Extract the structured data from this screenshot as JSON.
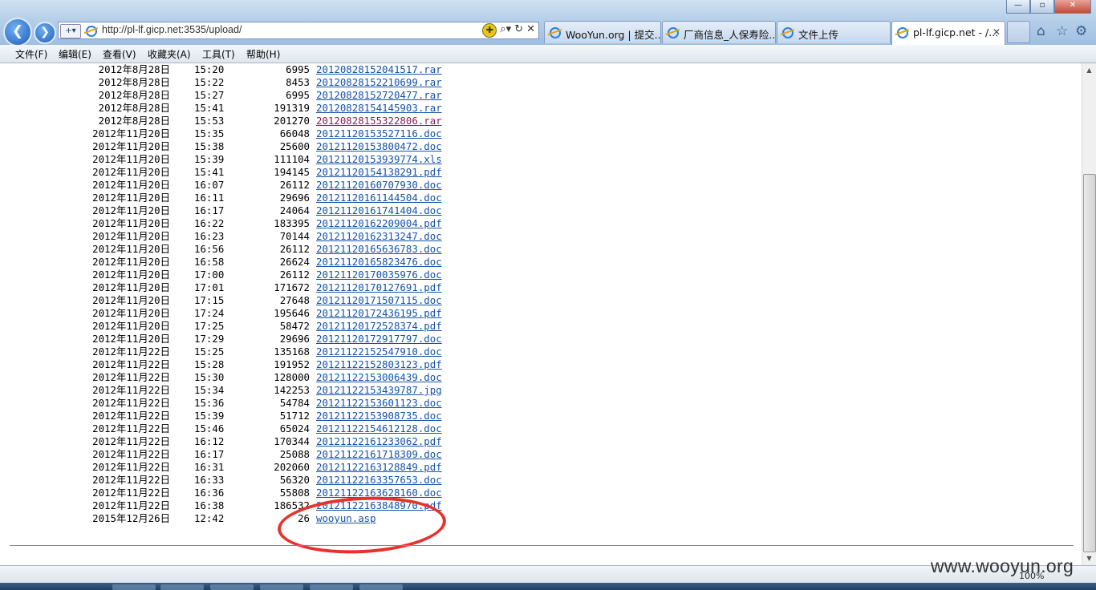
{
  "browser": {
    "url": "http://pl-lf.gicp.net:3535/upload/",
    "tabs": [
      {
        "label": "WooYun.org | 提交..."
      },
      {
        "label": "厂商信息_人保寿险..."
      },
      {
        "label": "文件上传"
      },
      {
        "label": "pl-lf.gicp.net - /..."
      }
    ],
    "window_buttons": {
      "minimize": "—",
      "maximize": "▫",
      "close": "✕"
    },
    "nav": {
      "back_glyph": "❮",
      "forward_glyph": "❯"
    },
    "address_icons": [
      "compat-view-icon",
      "search-icon",
      "refresh-icon",
      "stop-icon"
    ],
    "right_icons": [
      "home-icon",
      "favorites-star-icon",
      "tools-gear-icon"
    ]
  },
  "menu": [
    {
      "label": "文件(F)"
    },
    {
      "label": "编辑(E)"
    },
    {
      "label": "查看(V)"
    },
    {
      "label": "收藏夹(A)"
    },
    {
      "label": "工具(T)"
    },
    {
      "label": "帮助(H)"
    }
  ],
  "files": [
    {
      "date": "2012年8月28日",
      "time": "15:20",
      "size": "6995",
      "name": "20120828152041517.rar"
    },
    {
      "date": "2012年8月28日",
      "time": "15:22",
      "size": "8453",
      "name": "20120828152210699.rar"
    },
    {
      "date": "2012年8月28日",
      "time": "15:27",
      "size": "6995",
      "name": "20120828152720477.rar"
    },
    {
      "date": "2012年8月28日",
      "time": "15:41",
      "size": "191319",
      "name": "20120828154145903.rar"
    },
    {
      "date": "2012年8月28日",
      "time": "15:53",
      "size": "201270",
      "name": "20120828155322806.rar",
      "visited": true
    },
    {
      "date": "2012年11月20日",
      "time": "15:35",
      "size": "66048",
      "name": "20121120153527116.doc"
    },
    {
      "date": "2012年11月20日",
      "time": "15:38",
      "size": "25600",
      "name": "20121120153800472.doc"
    },
    {
      "date": "2012年11月20日",
      "time": "15:39",
      "size": "111104",
      "name": "20121120153939774.xls"
    },
    {
      "date": "2012年11月20日",
      "time": "15:41",
      "size": "194145",
      "name": "20121120154138291.pdf"
    },
    {
      "date": "2012年11月20日",
      "time": "16:07",
      "size": "26112",
      "name": "20121120160707930.doc"
    },
    {
      "date": "2012年11月20日",
      "time": "16:11",
      "size": "29696",
      "name": "20121120161144504.doc"
    },
    {
      "date": "2012年11月20日",
      "time": "16:17",
      "size": "24064",
      "name": "20121120161741404.doc"
    },
    {
      "date": "2012年11月20日",
      "time": "16:22",
      "size": "183395",
      "name": "20121120162209004.pdf"
    },
    {
      "date": "2012年11月20日",
      "time": "16:23",
      "size": "70144",
      "name": "20121120162313247.doc"
    },
    {
      "date": "2012年11月20日",
      "time": "16:56",
      "size": "26112",
      "name": "20121120165636783.doc"
    },
    {
      "date": "2012年11月20日",
      "time": "16:58",
      "size": "26624",
      "name": "20121120165823476.doc"
    },
    {
      "date": "2012年11月20日",
      "time": "17:00",
      "size": "26112",
      "name": "20121120170035976.doc"
    },
    {
      "date": "2012年11月20日",
      "time": "17:01",
      "size": "171672",
      "name": "20121120170127691.pdf"
    },
    {
      "date": "2012年11月20日",
      "time": "17:15",
      "size": "27648",
      "name": "20121120171507115.doc"
    },
    {
      "date": "2012年11月20日",
      "time": "17:24",
      "size": "195646",
      "name": "20121120172436195.pdf"
    },
    {
      "date": "2012年11月20日",
      "time": "17:25",
      "size": "58472",
      "name": "20121120172528374.pdf"
    },
    {
      "date": "2012年11月20日",
      "time": "17:29",
      "size": "29696",
      "name": "20121120172917797.doc"
    },
    {
      "date": "2012年11月22日",
      "time": "15:25",
      "size": "135168",
      "name": "20121122152547910.doc"
    },
    {
      "date": "2012年11月22日",
      "time": "15:28",
      "size": "191952",
      "name": "20121122152803123.pdf"
    },
    {
      "date": "2012年11月22日",
      "time": "15:30",
      "size": "128000",
      "name": "20121122153006439.doc"
    },
    {
      "date": "2012年11月22日",
      "time": "15:34",
      "size": "142253",
      "name": "20121122153439787.jpg"
    },
    {
      "date": "2012年11月22日",
      "time": "15:36",
      "size": "54784",
      "name": "20121122153601123.doc"
    },
    {
      "date": "2012年11月22日",
      "time": "15:39",
      "size": "51712",
      "name": "20121122153908735.doc"
    },
    {
      "date": "2012年11月22日",
      "time": "15:46",
      "size": "65024",
      "name": "20121122154612128.doc"
    },
    {
      "date": "2012年11月22日",
      "time": "16:12",
      "size": "170344",
      "name": "20121122161233062.pdf"
    },
    {
      "date": "2012年11月22日",
      "time": "16:17",
      "size": "25088",
      "name": "20121122161718309.doc"
    },
    {
      "date": "2012年11月22日",
      "time": "16:31",
      "size": "202060",
      "name": "20121122163128849.pdf"
    },
    {
      "date": "2012年11月22日",
      "time": "16:33",
      "size": "56320",
      "name": "20121122163357653.doc"
    },
    {
      "date": "2012年11月22日",
      "time": "16:36",
      "size": "55808",
      "name": "20121122163628160.doc"
    },
    {
      "date": "2012年11月22日",
      "time": "16:38",
      "size": "186532",
      "name": "20121122163848970.pdf"
    },
    {
      "date": "2015年12月26日",
      "time": "12:42",
      "size": "26",
      "name": "wooyun.asp"
    }
  ],
  "status": {
    "zoom": "100%"
  },
  "watermark": "www.wooyun.org",
  "colors": {
    "link": "#1652a8",
    "visited_link": "#8a1d5d",
    "annotation": "#e8312d"
  }
}
